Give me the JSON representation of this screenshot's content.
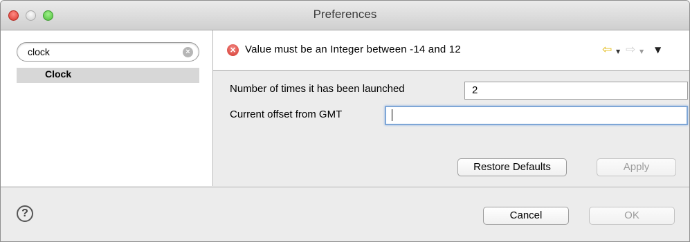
{
  "window": {
    "title": "Preferences"
  },
  "sidebar": {
    "filter_value": "clock",
    "items": [
      {
        "label": "Clock",
        "selected": true
      }
    ]
  },
  "message_bar": {
    "text": "Value must be an Integer between -14 and 12",
    "status": "error",
    "icon": "error-icon",
    "nav_icons": [
      "back-arrow-icon",
      "dropdown-caret-icon",
      "forward-arrow-icon",
      "dropdown-caret-icon",
      "view-menu-icon"
    ]
  },
  "form": {
    "launch_count_label": "Number of times it has been launched",
    "launch_count_value": "2",
    "gmt_offset_label": "Current offset from GMT",
    "gmt_offset_value": ""
  },
  "buttons": {
    "restore_defaults": "Restore Defaults",
    "apply": "Apply",
    "cancel": "Cancel",
    "ok": "OK"
  },
  "colors": {
    "error": "#d2352c",
    "focus_ring": "#7ea6d6",
    "selection": "#d7d7d7",
    "back_arrow": "#e0b400"
  }
}
